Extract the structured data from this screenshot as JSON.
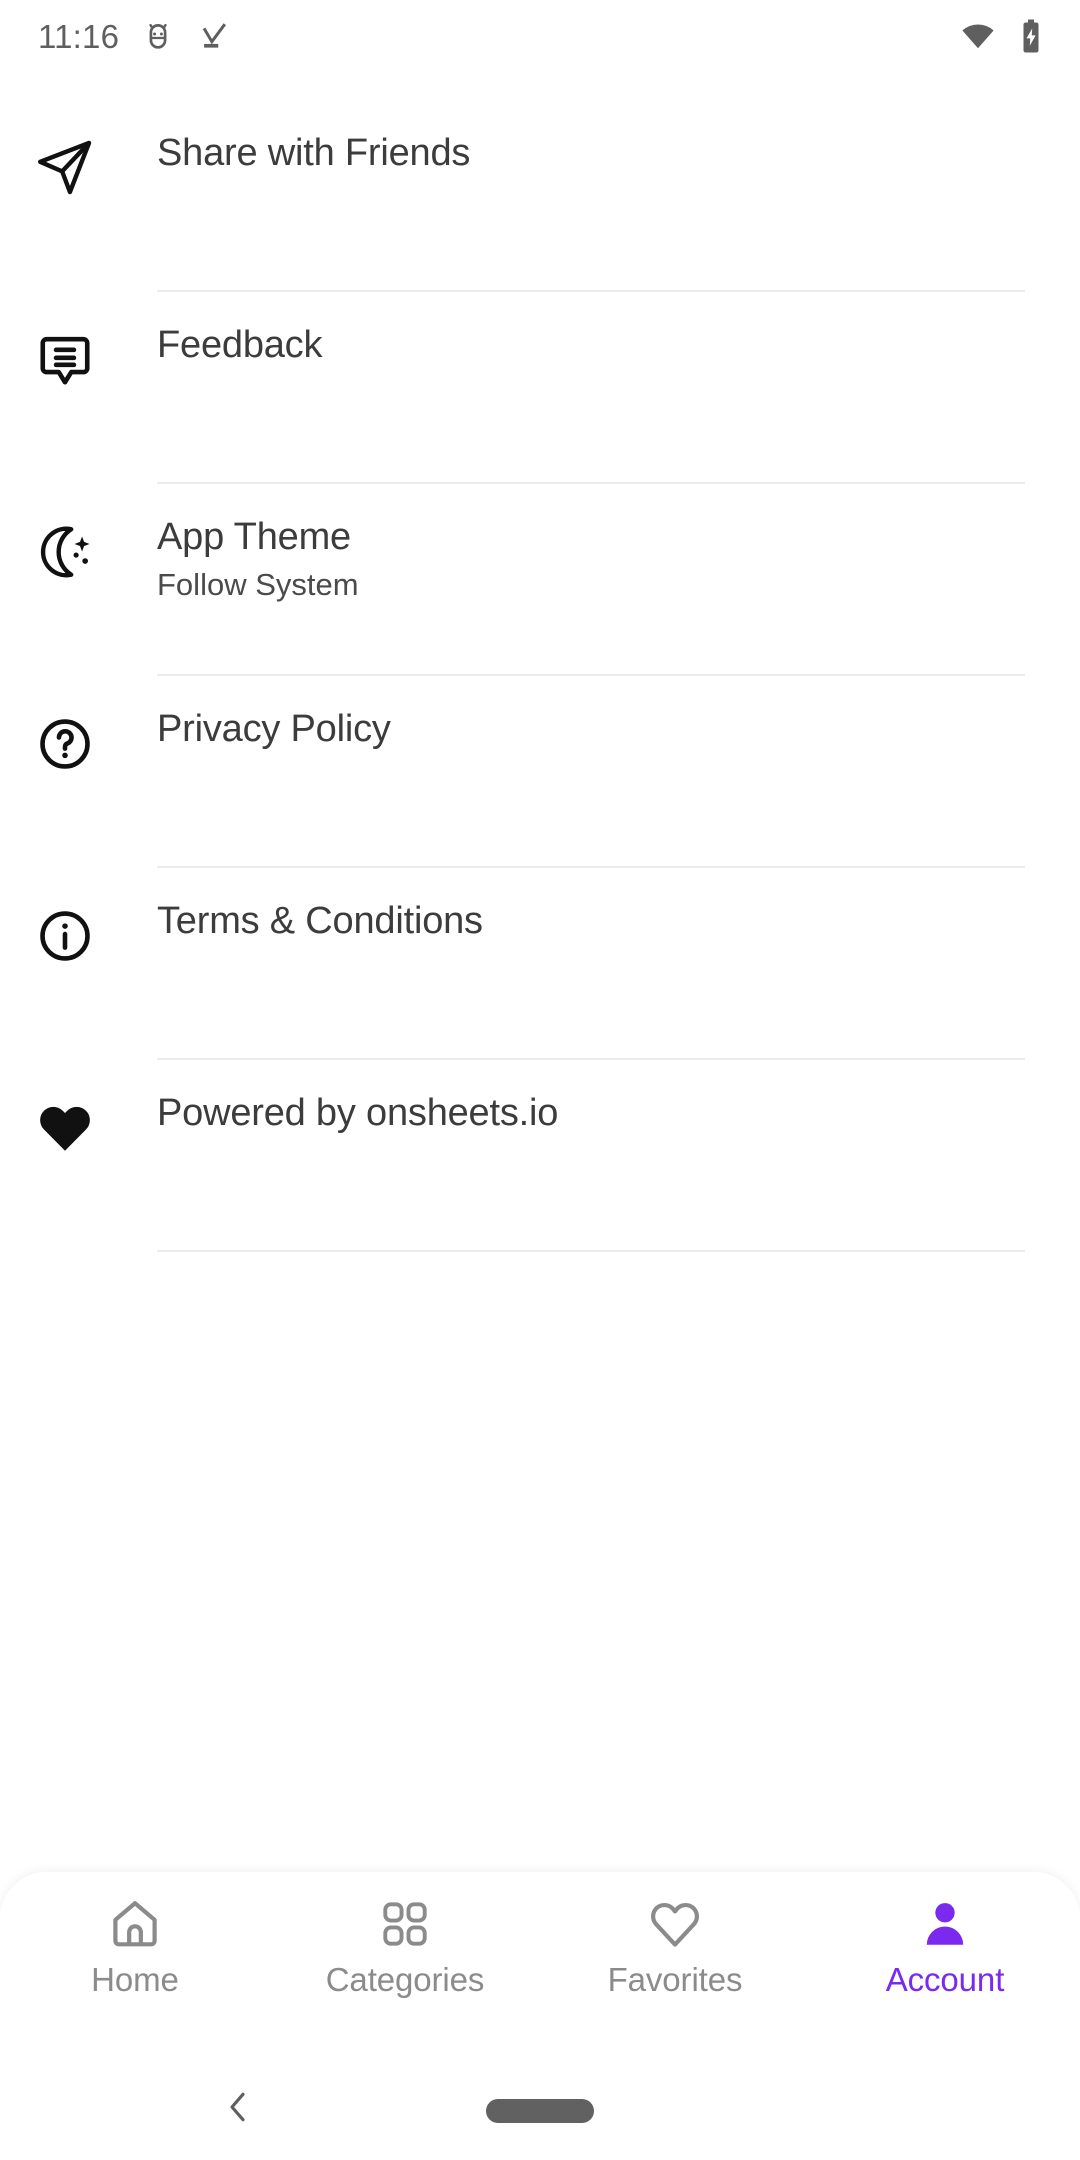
{
  "status_bar": {
    "time": "11:16",
    "left_icons": [
      "android-head-icon",
      "download-complete-icon"
    ],
    "right_icons": [
      "wifi-icon",
      "battery-charging-icon"
    ],
    "icon_color": "#5f5f5f"
  },
  "settings": {
    "items": [
      {
        "icon": "send-icon",
        "title": "Share with Friends",
        "subtitle": ""
      },
      {
        "icon": "feedback-icon",
        "title": "Feedback",
        "subtitle": ""
      },
      {
        "icon": "moon-stars-icon",
        "title": "App Theme",
        "subtitle": "Follow System"
      },
      {
        "icon": "help-circle-icon",
        "title": "Privacy Policy",
        "subtitle": ""
      },
      {
        "icon": "info-circle-icon",
        "title": "Terms & Conditions",
        "subtitle": ""
      },
      {
        "icon": "heart-filled-icon",
        "title": "Powered by onsheets.io",
        "subtitle": ""
      }
    ]
  },
  "bottom_nav": {
    "active_color": "#7b29ef",
    "inactive_color": "#8b8b8b",
    "items": [
      {
        "label": "Home",
        "icon": "home-icon",
        "active": false
      },
      {
        "label": "Categories",
        "icon": "grid-icon",
        "active": false
      },
      {
        "label": "Favorites",
        "icon": "heart-icon",
        "active": false
      },
      {
        "label": "Account",
        "icon": "person-icon",
        "active": true
      }
    ]
  },
  "system_nav": {
    "back_icon": "chevron-left-icon",
    "home_indicator": "home-pill-indicator"
  }
}
